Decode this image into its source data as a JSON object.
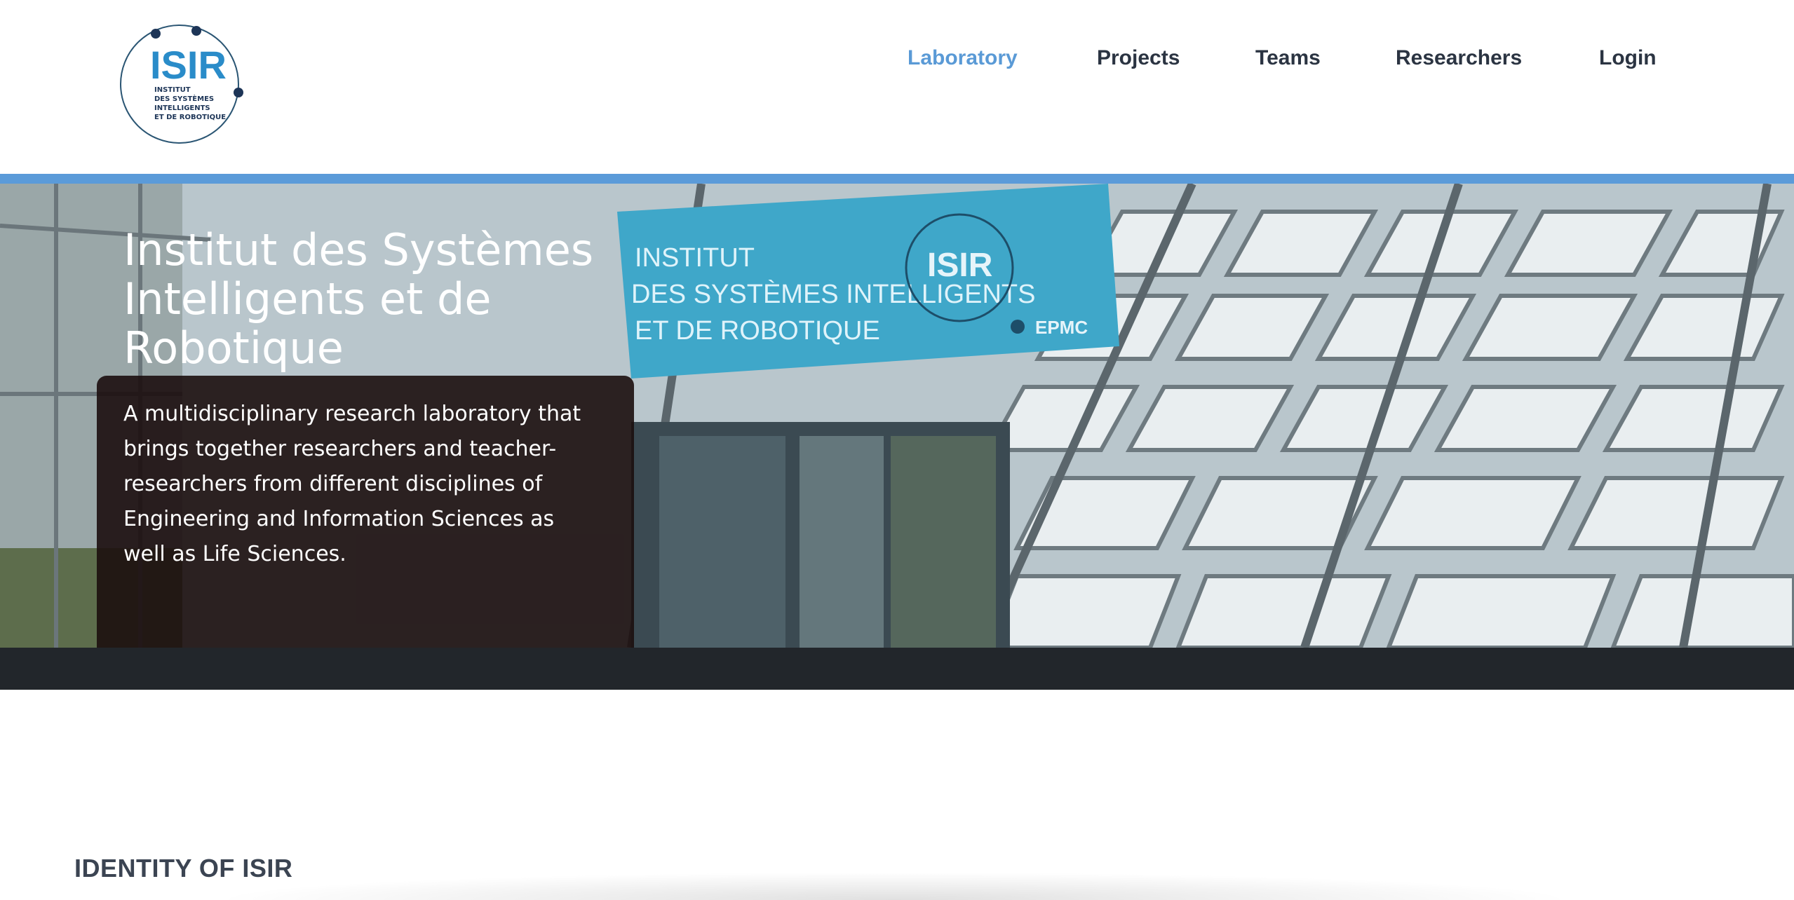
{
  "logo": {
    "mark": "ISIR",
    "lines": [
      "INSTITUT",
      "DES SYSTÈMES",
      "INTELLIGENTS",
      "ET DE ROBOTIQUE"
    ]
  },
  "nav": {
    "items": [
      {
        "label": "Laboratory",
        "active": true
      },
      {
        "label": "Projects",
        "active": false
      },
      {
        "label": "Teams",
        "active": false
      },
      {
        "label": "Researchers",
        "active": false
      },
      {
        "label": "Login",
        "active": false
      }
    ]
  },
  "hero": {
    "title": "Institut des Systèmes Intelligents et de Robotique",
    "description": "A multidisciplinary research laboratory that brings together researchers and teacher-researchers from different disciplines of Engineering and Information Sciences as well as Life Sciences.",
    "sign_lines": [
      "INSTITUT",
      "DES SYSTÈMES INTELLIGENTS",
      "ET DE ROBOTIQUE"
    ],
    "sign_logo": "ISIR",
    "sign_partner": "EPMC"
  },
  "section": {
    "title": "IDENTITY OF ISIR"
  },
  "colors": {
    "accent": "#5b9bd9",
    "nav_text": "#2b3442",
    "dark_band": "#22262b",
    "logo_blue": "#2a8cc9"
  }
}
